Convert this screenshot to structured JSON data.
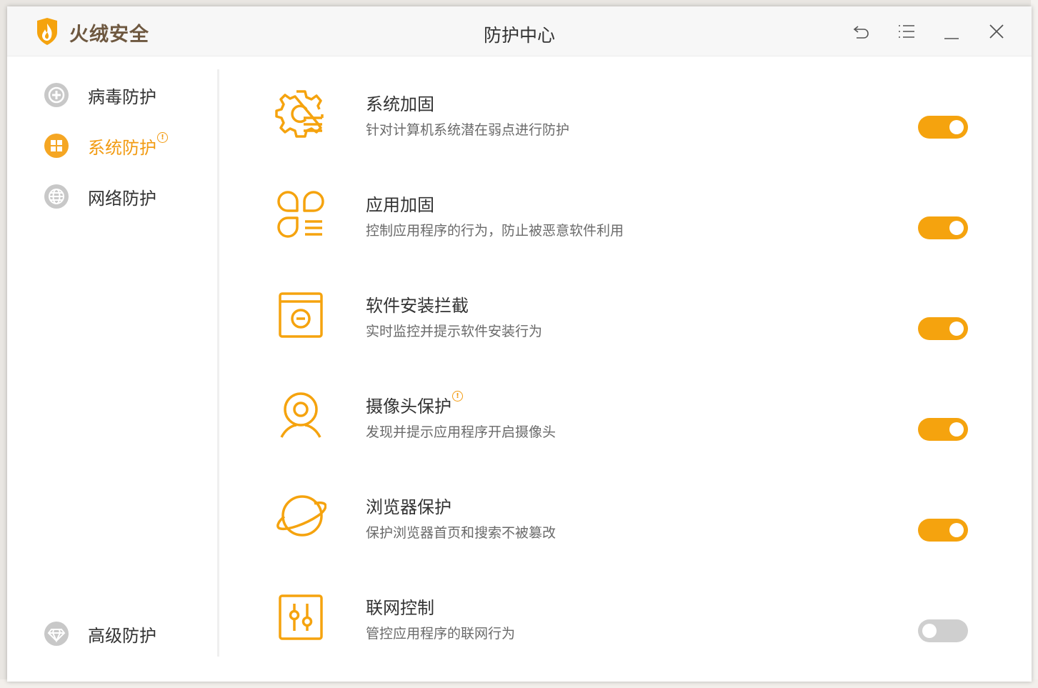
{
  "window": {
    "brand": "火绒安全",
    "title": "防护中心"
  },
  "titlebar_buttons": [
    "back-icon",
    "menu-icon",
    "minimize-icon",
    "close-icon"
  ],
  "sidebar": {
    "items": [
      {
        "label": "病毒防护",
        "icon": "plus-circle-icon",
        "active": false,
        "alert": false
      },
      {
        "label": "系统防护",
        "icon": "windows-icon",
        "active": true,
        "alert": true
      },
      {
        "label": "网络防护",
        "icon": "globe-icon",
        "active": false,
        "alert": false
      }
    ],
    "bottom_item": {
      "label": "高级防护",
      "icon": "diamond-icon"
    }
  },
  "features": [
    {
      "title": "系统加固",
      "description": "针对计算机系统潜在弱点进行防护",
      "icon": "gear-list-icon",
      "enabled": true,
      "alert": false
    },
    {
      "title": "应用加固",
      "description": "控制应用程序的行为，防止被恶意软件利用",
      "icon": "app-grid-icon",
      "enabled": true,
      "alert": false
    },
    {
      "title": "软件安装拦截",
      "description": "实时监控并提示软件安装行为",
      "icon": "install-block-icon",
      "enabled": true,
      "alert": false
    },
    {
      "title": "摄像头保护",
      "description": "发现并提示应用程序开启摄像头",
      "icon": "camera-icon",
      "enabled": true,
      "alert": true
    },
    {
      "title": "浏览器保护",
      "description": "保护浏览器首页和搜索不被篡改",
      "icon": "planet-icon",
      "enabled": true,
      "alert": false
    },
    {
      "title": "联网控制",
      "description": "管控应用程序的联网行为",
      "icon": "slider-control-icon",
      "enabled": false,
      "alert": false
    }
  ],
  "colors": {
    "accent": "#f5a30e",
    "active_text": "#f29b12",
    "toggle_off": "#cfcfcf",
    "brand_text": "#6e5840"
  }
}
